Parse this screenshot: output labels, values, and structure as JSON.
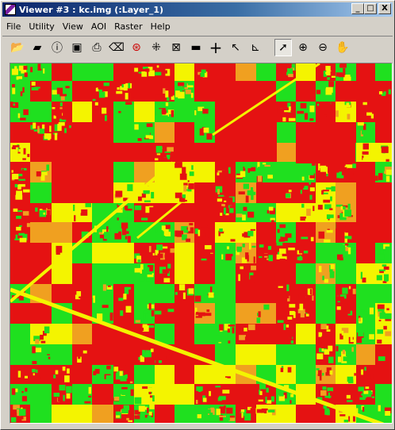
{
  "window": {
    "title": "Viewer #3 : kc.img (:Layer_1)",
    "controls": {
      "minimize": "_",
      "maximize": "□",
      "close": "X"
    }
  },
  "menu": [
    {
      "label": "File",
      "accel": "F"
    },
    {
      "label": "Utility",
      "accel": "U"
    },
    {
      "label": "View",
      "accel": "V"
    },
    {
      "label": "AOI",
      "accel": "O"
    },
    {
      "label": "Raster",
      "accel": "R"
    },
    {
      "label": "Help",
      "accel": "H"
    }
  ],
  "toolbar": [
    {
      "name": "open-folder-icon",
      "glyph": "📂"
    },
    {
      "name": "open-layer-icon",
      "glyph": "▰"
    },
    {
      "name": "info-icon",
      "glyph": "ⓘ"
    },
    {
      "name": "save-icon",
      "glyph": "▣"
    },
    {
      "name": "print-icon",
      "glyph": "⎙"
    },
    {
      "name": "eraser-icon",
      "glyph": "⌫"
    },
    {
      "name": "radiometric-icon",
      "glyph": "⊛"
    },
    {
      "name": "zoom-extent-icon",
      "glyph": "⁜"
    },
    {
      "name": "fit-window-icon",
      "glyph": "⊠"
    },
    {
      "name": "measure-icon",
      "glyph": "▬"
    },
    {
      "name": "crosshair-icon",
      "glyph": "+"
    },
    {
      "name": "arrow-tool-icon",
      "glyph": "↖"
    },
    {
      "name": "profile-icon",
      "glyph": "⊾"
    },
    {
      "name": "select-pointer-icon",
      "glyph": "➚",
      "active": true
    },
    {
      "name": "zoom-in-icon",
      "glyph": "⊕"
    },
    {
      "name": "zoom-out-icon",
      "glyph": "⊖"
    },
    {
      "name": "pan-hand-icon",
      "glyph": "✋"
    }
  ],
  "palette": {
    "red": "#e51212",
    "green": "#1fe01f",
    "yellow": "#f4f400",
    "orange": "#f0a020"
  }
}
